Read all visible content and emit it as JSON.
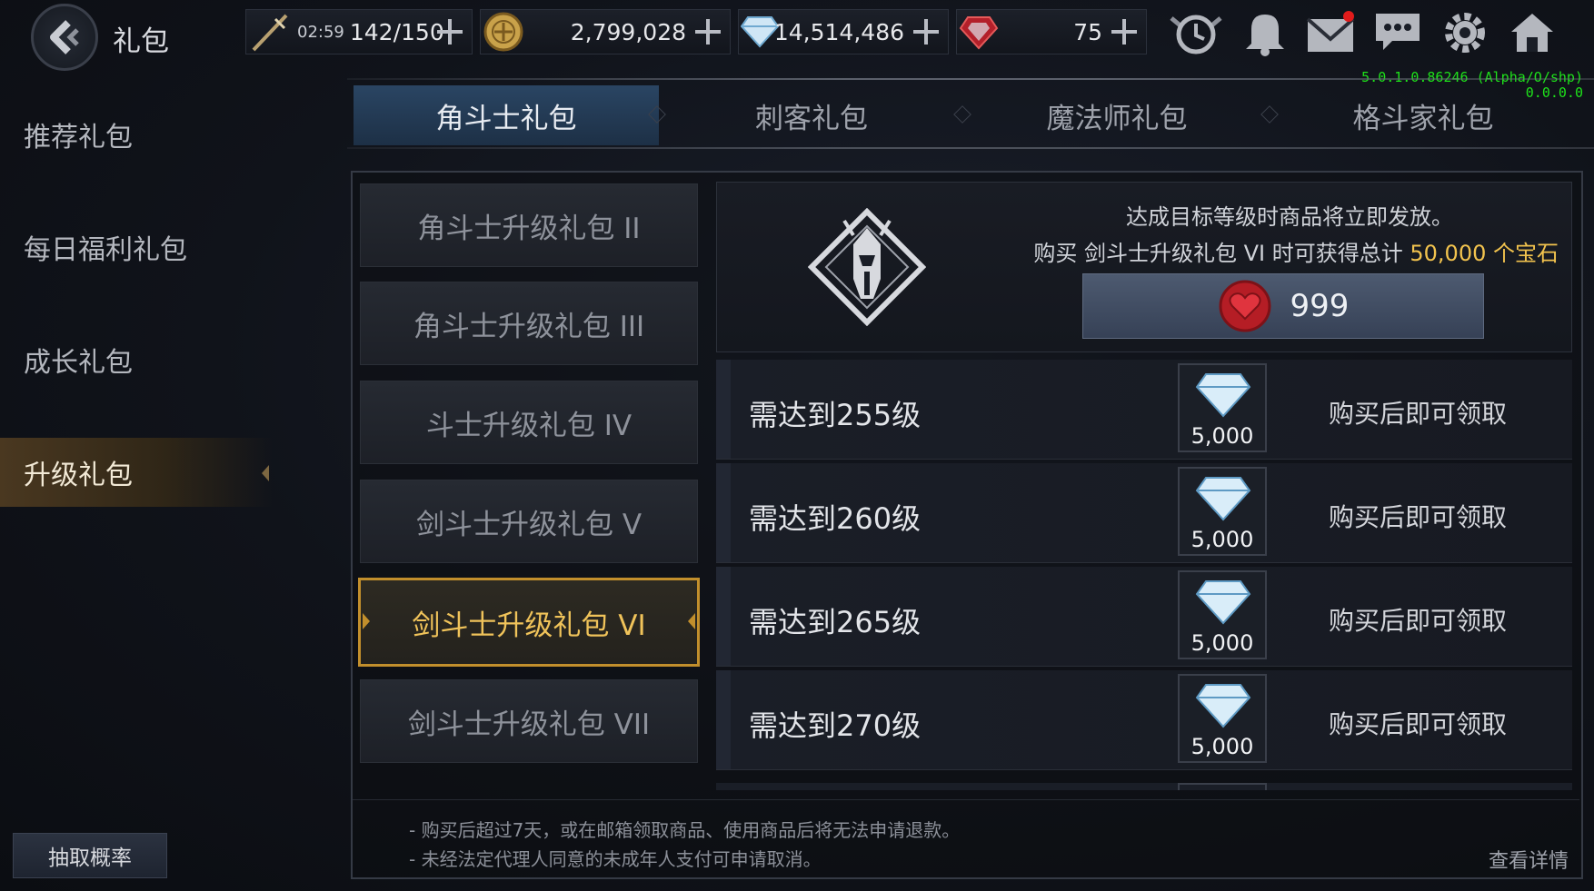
{
  "header": {
    "title": "礼包",
    "stamina": {
      "timer": "02:59",
      "value": "142/150",
      "icon": "sword-icon"
    },
    "gold": {
      "value": "2,799,028",
      "icon": "gold-coin-icon"
    },
    "diamonds": {
      "value": "14,514,486",
      "icon": "diamond-icon"
    },
    "ruby": {
      "value": "75",
      "icon": "ruby-gem-icon"
    },
    "icons": [
      "clock-wings-icon",
      "bell-icon",
      "mail-icon",
      "chat-icon",
      "gear-icon",
      "home-icon"
    ],
    "mail_has_notification": true,
    "version_line1": "5.0.1.0.86246 (Alpha/O/shp)",
    "version_line2": "0.0.0.0"
  },
  "sidebar": {
    "items": [
      {
        "label": "推荐礼包",
        "active": false
      },
      {
        "label": "每日福利礼包",
        "active": false
      },
      {
        "label": "成长礼包",
        "active": false
      },
      {
        "label": "升级礼包",
        "active": true
      }
    ],
    "odds_button": "抽取概率"
  },
  "tabs": [
    {
      "label": "角斗士礼包",
      "active": true
    },
    {
      "label": "刺客礼包",
      "active": false
    },
    {
      "label": "魔法师礼包",
      "active": false
    },
    {
      "label": "格斗家礼包",
      "active": false
    }
  ],
  "packs": [
    {
      "label": "角斗士升级礼包 II",
      "selected": false
    },
    {
      "label": "角斗士升级礼包 III",
      "selected": false
    },
    {
      "label": "斗士升级礼包 IV",
      "selected": false
    },
    {
      "label": "剑斗士升级礼包 V",
      "selected": false
    },
    {
      "label": "剑斗士升级礼包 VI",
      "selected": true
    },
    {
      "label": "剑斗士升级礼包 VII",
      "selected": false
    }
  ],
  "detail": {
    "emblem": "gladiator-helmet-emblem-icon",
    "line1": "达成目标等级时商品将立即发放。",
    "line2_prefix": "购买 剑斗士升级礼包 VI 时可获得总计 ",
    "line2_highlight": "50,000 个宝石",
    "price": "999",
    "price_icon": "red-heart-gem-icon"
  },
  "rewards": [
    {
      "level": "需达到255级",
      "amount": "5,000",
      "status": "购买后即可领取"
    },
    {
      "level": "需达到260级",
      "amount": "5,000",
      "status": "购买后即可领取"
    },
    {
      "level": "需达到265级",
      "amount": "5,000",
      "status": "购买后即可领取"
    },
    {
      "level": "需达到270级",
      "amount": "5,000",
      "status": "购买后即可领取"
    }
  ],
  "notes": [
    "- 购买后超过7天，或在邮箱领取商品、使用商品后将无法申请退款。",
    "- 未经法定代理人同意的未成年人支付可申请取消。"
  ],
  "details_link": "查看详情",
  "colors": {
    "accent_gold": "#c28f2c",
    "highlight_yellow": "#f2c34e",
    "tab_active": "#2a4563",
    "version_green": "#1ee31a"
  }
}
